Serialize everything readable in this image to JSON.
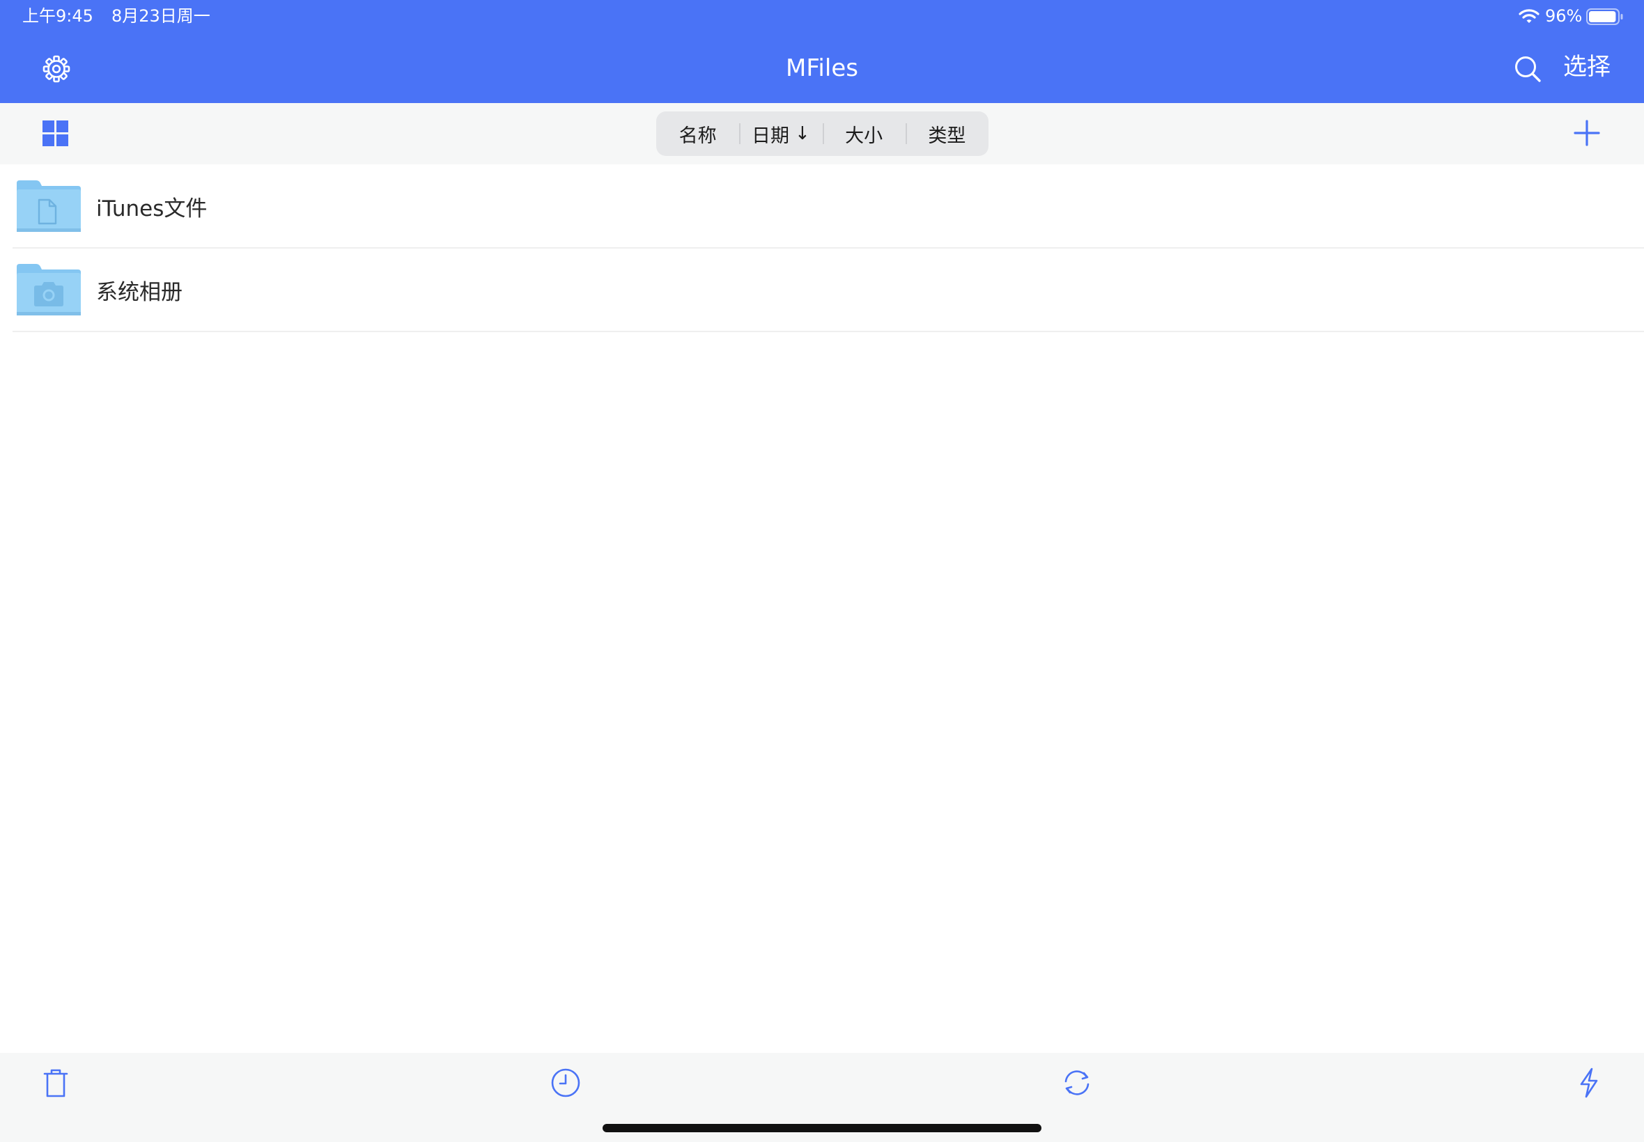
{
  "status_bar": {
    "time": "上午9:45",
    "date": "8月23日周一",
    "battery_percent": "96%",
    "battery_level": 0.96
  },
  "nav": {
    "title": "MFiles",
    "select_label": "选择",
    "icons": [
      "gear-icon",
      "search-icon"
    ]
  },
  "toolbar": {
    "sort_options": [
      {
        "label": "名称"
      },
      {
        "label": "日期",
        "direction": "↓",
        "active": true
      },
      {
        "label": "大小"
      },
      {
        "label": "类型"
      }
    ],
    "icons": [
      "grid-view-icon",
      "plus-icon"
    ]
  },
  "files": [
    {
      "name": "iTunes文件",
      "icon": "document-folder-icon"
    },
    {
      "name": "系统相册",
      "icon": "camera-folder-icon"
    }
  ],
  "bottom_bar": {
    "icons": [
      "trash-icon",
      "history-icon",
      "sync-icon",
      "bolt-icon"
    ]
  },
  "colors": {
    "accent": "#4a73f6",
    "toolbar_bg": "#f6f7f7",
    "segment_bg": "#e6e7e9",
    "folder": "#90cef4"
  }
}
